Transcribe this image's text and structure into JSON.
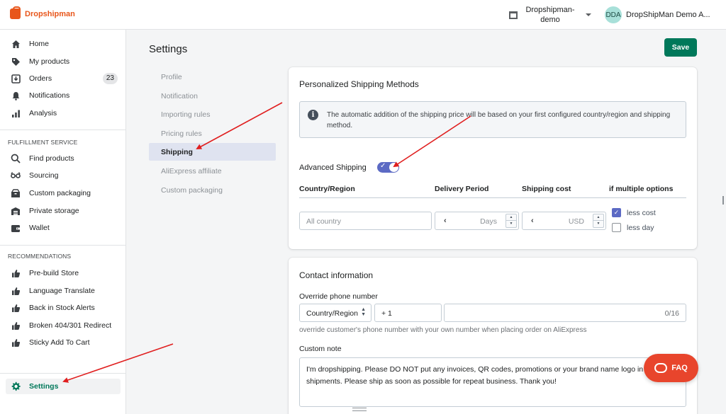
{
  "app": {
    "logo_text": "Dropshipman"
  },
  "topbar": {
    "store_name": "Dropshipman-demo",
    "user_initials": "DDA",
    "user_name": "DropShipMan Demo A..."
  },
  "sidebar": {
    "main_items": [
      {
        "label": "Home",
        "icon": "home-icon"
      },
      {
        "label": "My products",
        "icon": "tag-icon"
      },
      {
        "label": "Orders",
        "icon": "orders-icon",
        "badge": "23"
      },
      {
        "label": "Notifications",
        "icon": "bell-icon"
      },
      {
        "label": "Analysis",
        "icon": "bar-chart-icon"
      }
    ],
    "fulfillment_title": "FULFILLMENT SERVICE",
    "fulfillment_items": [
      {
        "label": "Find products",
        "icon": "search-icon"
      },
      {
        "label": "Sourcing",
        "icon": "sourcing-icon"
      },
      {
        "label": "Custom packaging",
        "icon": "package-icon"
      },
      {
        "label": "Private storage",
        "icon": "warehouse-icon"
      },
      {
        "label": "Wallet",
        "icon": "wallet-icon"
      }
    ],
    "recommend_title": "RECOMMENDATIONS",
    "recommend_items": [
      {
        "label": "Pre-build Store",
        "icon": "thumbs-up-icon"
      },
      {
        "label": "Language Translate",
        "icon": "thumbs-up-icon"
      },
      {
        "label": "Back in Stock Alerts",
        "icon": "thumbs-up-icon"
      },
      {
        "label": "Broken 404/301 Redirect",
        "icon": "thumbs-up-icon"
      },
      {
        "label": "Sticky Add To Cart",
        "icon": "thumbs-up-icon"
      }
    ],
    "settings_label": "Settings"
  },
  "page": {
    "title": "Settings",
    "save_label": "Save"
  },
  "subnav": [
    {
      "label": "Profile"
    },
    {
      "label": "Notification"
    },
    {
      "label": "Importing rules"
    },
    {
      "label": "Pricing rules"
    },
    {
      "label": "Shipping",
      "active": true
    },
    {
      "label": "AliExpress affiliate"
    },
    {
      "label": "Custom packaging"
    }
  ],
  "shipping": {
    "title": "Personalized Shipping Methods",
    "info": "The automatic addition of the shipping price will be based on your first configured country/region and shipping method.",
    "advanced_label": "Advanced Shipping",
    "advanced_enabled": true,
    "columns": [
      "Country/Region",
      "Delivery Period",
      "Shipping cost",
      "if multiple options"
    ],
    "country_placeholder": "All country",
    "days_unit": "Days",
    "cost_unit": "USD",
    "options": [
      {
        "label": "less cost",
        "checked": true
      },
      {
        "label": "less day",
        "checked": false
      }
    ]
  },
  "contact": {
    "title": "Contact information",
    "phone_label": "Override phone number",
    "country_select": "Country/Region",
    "country_code": "+ 1",
    "char_count": "0/16",
    "phone_helper": "override customer's phone number with your own number when placing order on AliExpress",
    "note_label": "Custom note",
    "note_text": "I'm dropshipping. Please DO NOT put any invoices, QR codes, promotions or your brand name logo in the shipments. Please ship as soon as possible for repeat business. Thank you!"
  },
  "faq_label": "FAQ",
  "colors": {
    "brand": "#e8561b",
    "primary": "#00785a",
    "toggle": "#5c6ac4",
    "faq": "#e8452c",
    "annotation": "#e01f1f"
  }
}
